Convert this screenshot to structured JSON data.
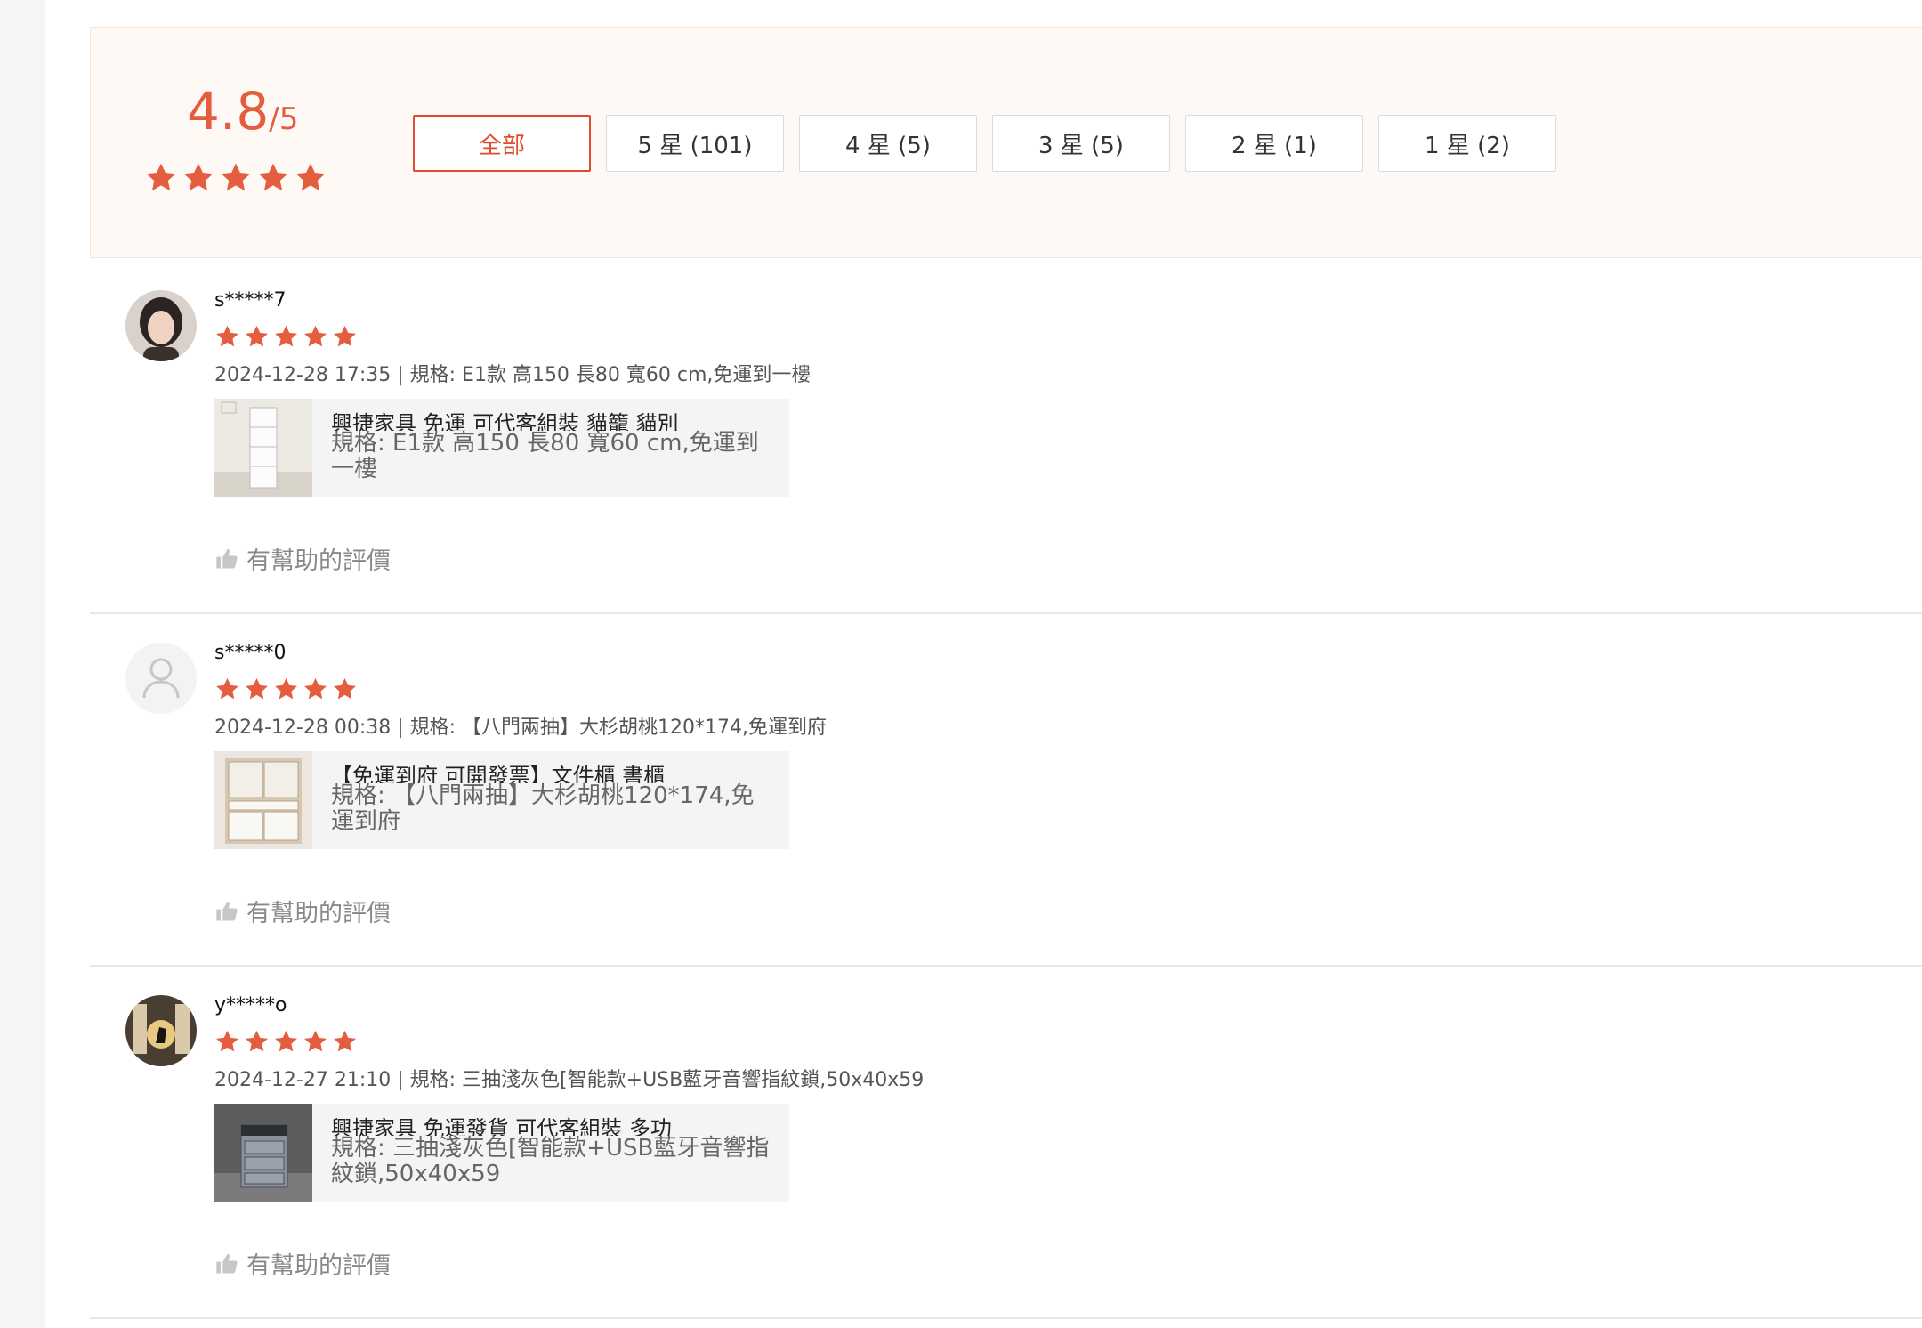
{
  "summary": {
    "score": "4.8",
    "score_out_of": "/5",
    "star_rating": 5,
    "accent_color": "#e35d3e",
    "filters": [
      {
        "label": "全部",
        "active": true
      },
      {
        "label": "5 星 (101)",
        "active": false
      },
      {
        "label": "4 星 (5)",
        "active": false
      },
      {
        "label": "3 星 (5)",
        "active": false
      },
      {
        "label": "2 星 (1)",
        "active": false
      },
      {
        "label": "1 星 (2)",
        "active": false
      }
    ]
  },
  "reviews": [
    {
      "username": "s*****7",
      "rating": 5,
      "meta": "2024-12-28 17:35 | 規格: E1款 高150 長80 寬60 cm,免運到一樓",
      "product_title": "興捷家具 免運 可代客組裝 貓籠 貓別",
      "product_spec": "規格: E1款 高150 長80 寬60 cm,免運到一樓",
      "helpful_label": "有幫助的評價",
      "avatar": "user-photo"
    },
    {
      "username": "s*****0",
      "rating": 5,
      "meta": "2024-12-28 00:38 | 規格: 【八門兩抽】大杉胡桃120*174,免運到府",
      "product_title": "【免運到府 可開發票】文件櫃 書櫃",
      "product_spec": "規格: 【八門兩抽】大杉胡桃120*174,免運到府",
      "helpful_label": "有幫助的評價",
      "avatar": "default-user-icon"
    },
    {
      "username": "y*****o",
      "rating": 5,
      "meta": "2024-12-27 21:10 | 規格: 三抽淺灰色[智能款+USB藍牙音響指紋鎖,50x40x59",
      "product_title": "興捷家具 免運發貨 可代客組裝 多功",
      "product_spec": "規格: 三抽淺灰色[智能款+USB藍牙音響指紋鎖,50x40x59",
      "helpful_label": "有幫助的評價",
      "avatar": "user-photo"
    }
  ]
}
